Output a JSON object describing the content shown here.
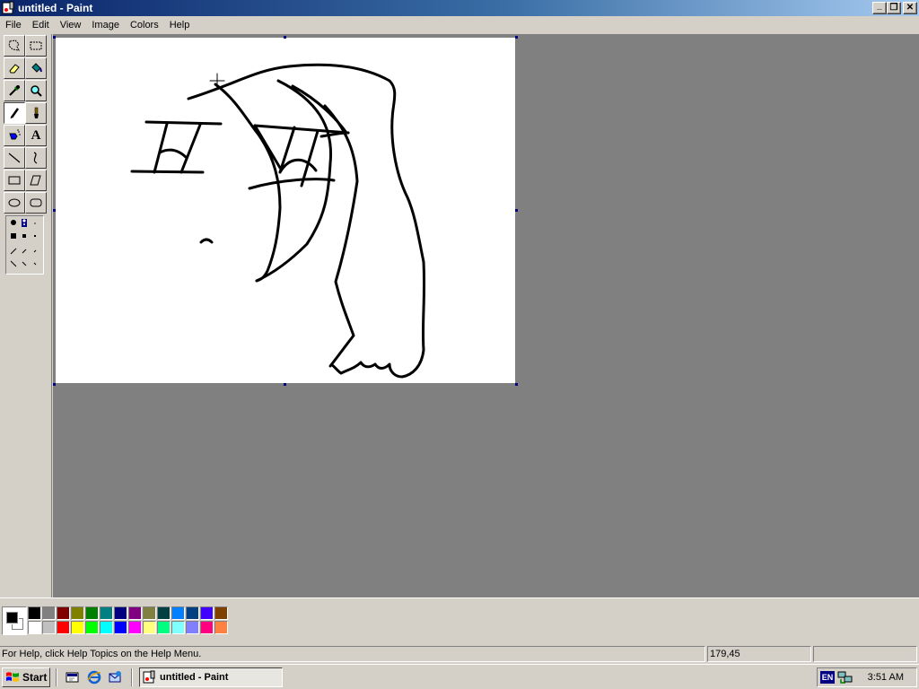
{
  "window": {
    "title": "untitled - Paint",
    "caption_buttons": {
      "minimize": "_",
      "restore": "❐",
      "close": "✕"
    }
  },
  "menu": [
    "File",
    "Edit",
    "View",
    "Image",
    "Colors",
    "Help"
  ],
  "toolbox": {
    "tools": [
      {
        "name": "free-form-select",
        "icon": "free-form-select-icon"
      },
      {
        "name": "select",
        "icon": "select-icon"
      },
      {
        "name": "eraser",
        "icon": "eraser-icon"
      },
      {
        "name": "fill-with-color",
        "icon": "paint-bucket-icon"
      },
      {
        "name": "pick-color",
        "icon": "eyedropper-icon"
      },
      {
        "name": "magnifier",
        "icon": "magnifier-icon"
      },
      {
        "name": "pencil",
        "icon": "pencil-icon",
        "selected": true
      },
      {
        "name": "brush",
        "icon": "brush-icon"
      },
      {
        "name": "airbrush",
        "icon": "airbrush-icon"
      },
      {
        "name": "text",
        "icon": "text-icon",
        "glyph": "A"
      },
      {
        "name": "line",
        "icon": "line-icon"
      },
      {
        "name": "curve",
        "icon": "curve-icon"
      },
      {
        "name": "rectangle",
        "icon": "rectangle-icon"
      },
      {
        "name": "polygon",
        "icon": "polygon-icon"
      },
      {
        "name": "ellipse",
        "icon": "ellipse-icon"
      },
      {
        "name": "rounded-rectangle",
        "icon": "rounded-rectangle-icon"
      }
    ]
  },
  "colors": {
    "foreground": "#000000",
    "background": "#ffffff",
    "palette": [
      "#000000",
      "#808080",
      "#800000",
      "#808000",
      "#008000",
      "#008080",
      "#000080",
      "#800080",
      "#808040",
      "#004040",
      "#0080ff",
      "#004080",
      "#4000ff",
      "#804000",
      "#ffffff",
      "#c0c0c0",
      "#ff0000",
      "#ffff00",
      "#00ff00",
      "#00ffff",
      "#0000ff",
      "#ff00ff",
      "#ffff80",
      "#00ff80",
      "#80ffff",
      "#8080ff",
      "#ff0080",
      "#ff8040"
    ]
  },
  "status": {
    "help_text": "For Help, click Help Topics on the Help Menu.",
    "coordinates": "179,45",
    "size": ""
  },
  "taskbar": {
    "start_label": "Start",
    "task_label": "untitled - Paint",
    "language": "EN",
    "clock": "3:51 AM"
  }
}
